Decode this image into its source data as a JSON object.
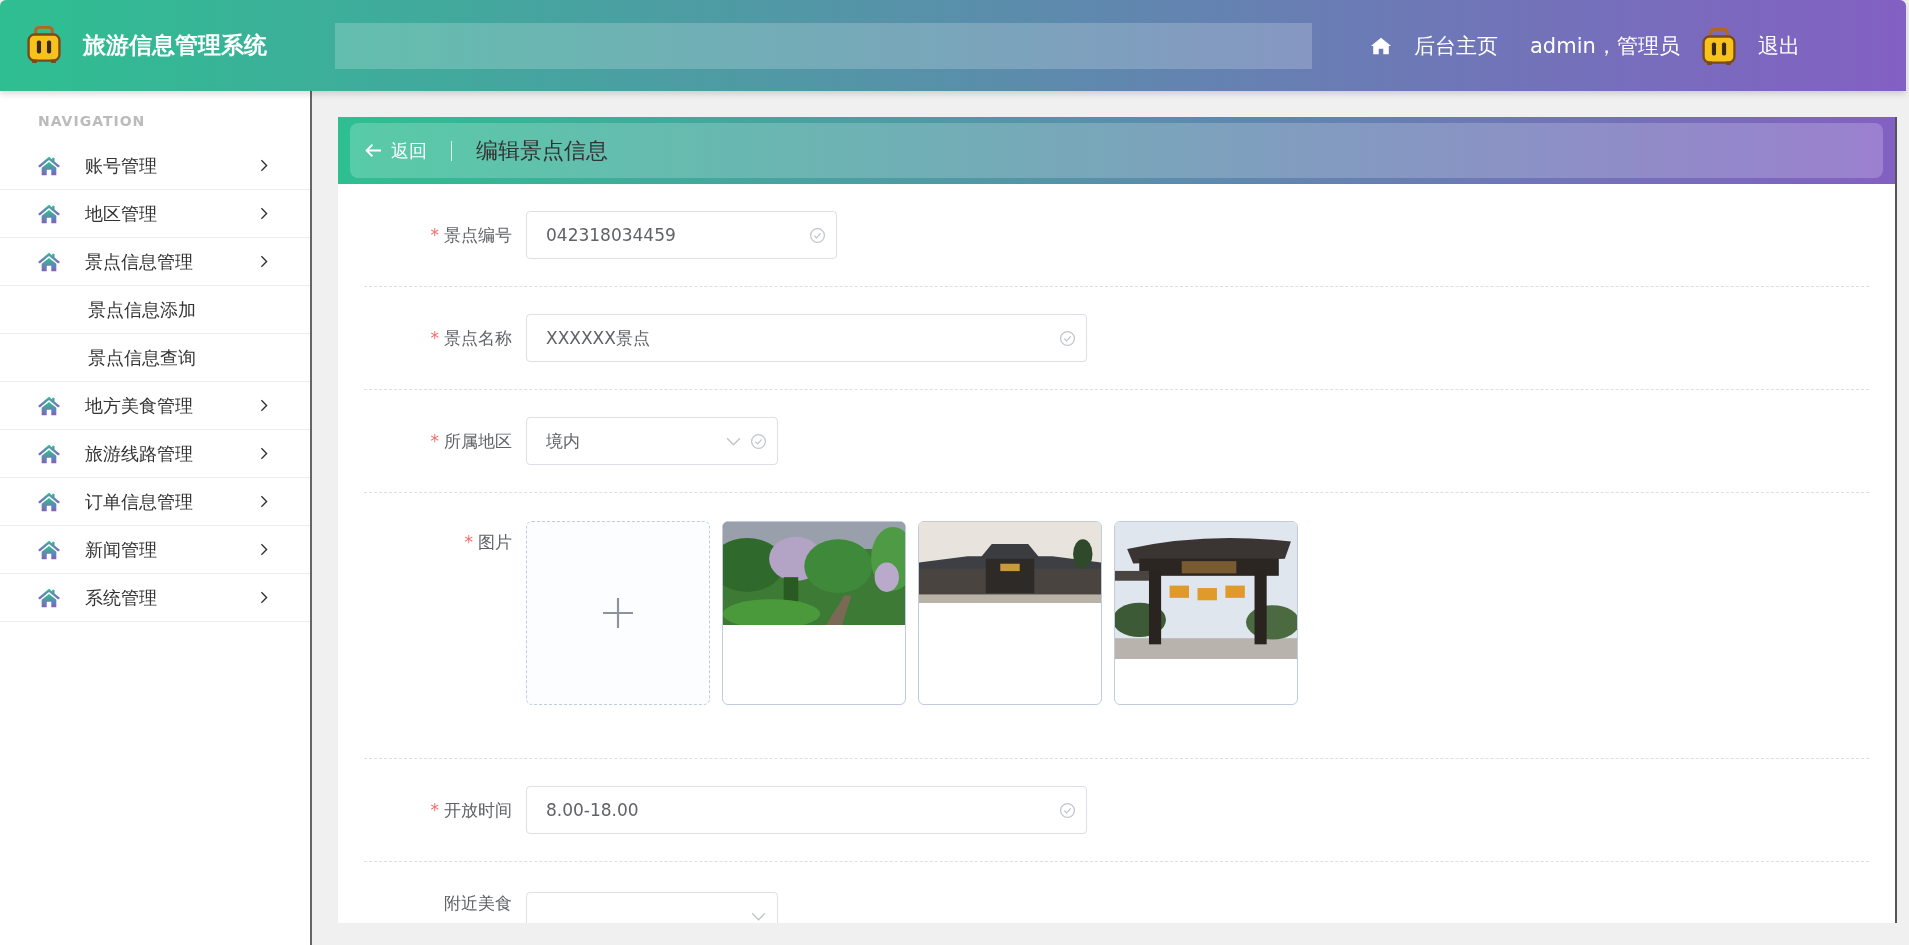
{
  "header": {
    "title": "旅游信息管理系统",
    "links": [
      {
        "kind": "home",
        "label": "后台主页"
      },
      {
        "kind": "user",
        "label": "admin，管理员"
      },
      {
        "kind": "logout",
        "label": "退出"
      }
    ]
  },
  "sidebar": {
    "heading": "NAVIGATION",
    "items": [
      {
        "label": "账号管理"
      },
      {
        "label": "地区管理"
      },
      {
        "label": "景点信息管理",
        "children": [
          {
            "label": "景点信息添加"
          },
          {
            "label": "景点信息查询"
          }
        ]
      },
      {
        "label": "地方美食管理"
      },
      {
        "label": "旅游线路管理"
      },
      {
        "label": "订单信息管理"
      },
      {
        "label": "新闻管理"
      },
      {
        "label": "系统管理"
      }
    ]
  },
  "page": {
    "back_label": "返回",
    "title": "编辑景点信息"
  },
  "form": {
    "fields": [
      {
        "kind": "text",
        "label": "景点编号",
        "required_mark": "*",
        "value": "042318034459",
        "valid": true
      },
      {
        "kind": "text",
        "label": "景点名称",
        "required_mark": "*",
        "value": "XXXXXX景点",
        "valid": true
      },
      {
        "kind": "select",
        "label": "所属地区",
        "required_mark": "*",
        "value": "境内",
        "valid": true
      },
      {
        "kind": "upload",
        "label": "图片",
        "required_mark": "*"
      },
      {
        "kind": "text",
        "label": "开放时间",
        "required_mark": "*",
        "value": "8.00-18.00",
        "valid": true
      },
      {
        "kind": "select",
        "label": "附近美食",
        "valid": false
      }
    ]
  }
}
